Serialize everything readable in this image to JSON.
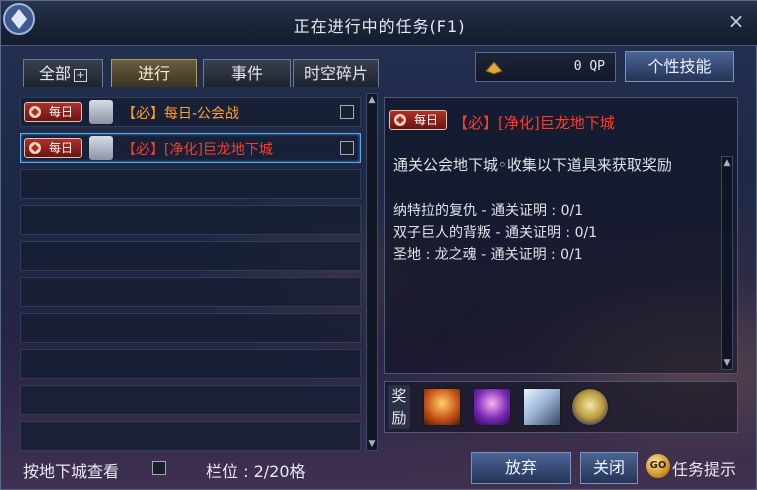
{
  "window": {
    "title": "正在进行中的任务(F1)",
    "close_glyph": "×"
  },
  "tabs": [
    {
      "label": "全部",
      "has_expand": true,
      "plus": "+"
    },
    {
      "label": "进行",
      "active": true
    },
    {
      "label": "事件"
    },
    {
      "label": "时空碎片"
    }
  ],
  "qp": {
    "value": "0 QP",
    "icon": "qp-coin-icon"
  },
  "skill_button": {
    "label": "个性技能"
  },
  "quests": [
    {
      "badge": "每日",
      "tag": "【必】",
      "name": "每日-公会战",
      "selected": false
    },
    {
      "badge": "每日",
      "tag": "【必】",
      "name": "[净化]巨龙地下城",
      "selected": true
    }
  ],
  "empty_rows": 8,
  "detail": {
    "badge": "每日",
    "title": "【必】[净化]巨龙地下城",
    "description": "通关公会地下城◦收集以下道具来获取奖励",
    "objectives": [
      "纳特拉的复仇 - 通关证明 : 0/1",
      "双子巨人的背叛 - 通关证明 : 0/1",
      "圣地 : 龙之魂 - 通关证明 : 0/1"
    ]
  },
  "rewards": {
    "label": "奖励",
    "items": [
      {
        "icon": "orange-chest-icon",
        "color": "#c8561a"
      },
      {
        "icon": "purple-box-icon",
        "color": "#7a2ab8"
      },
      {
        "icon": "crystal-icon",
        "color": "#9fb8d8"
      },
      {
        "icon": "gold-orb-icon",
        "color": "#b89a3a"
      }
    ]
  },
  "footer": {
    "filter_label": "按地下城查看",
    "slots_label": "栏位 : 2/20格",
    "abandon_label": "放弃",
    "close_label": "关闭",
    "hint_icon": "GO",
    "hint_label": "任务提示"
  },
  "colors": {
    "required_tag": "#ff3b2a",
    "daily_quest": "#ffa02a",
    "button_blue": "#3a5286",
    "selection": "#5aa9e8"
  }
}
